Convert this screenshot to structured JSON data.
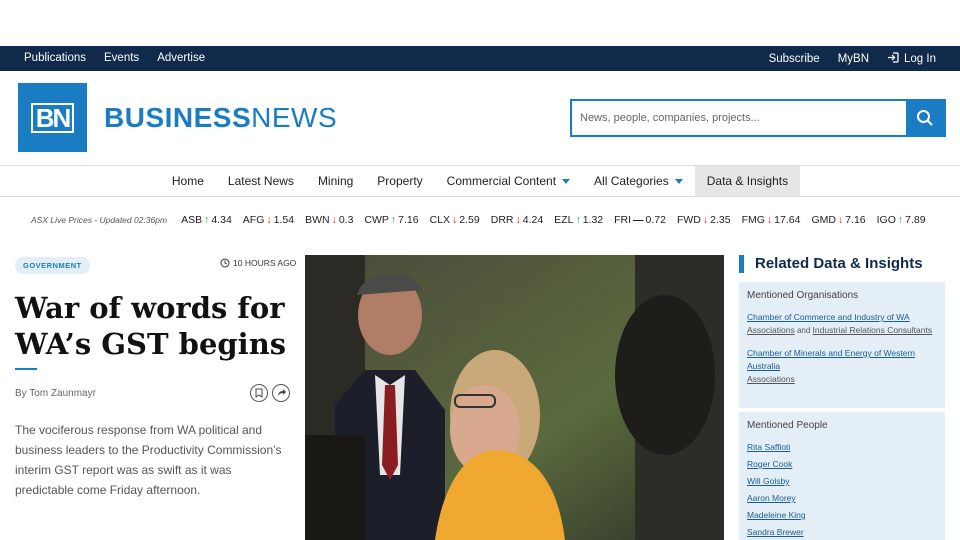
{
  "topbar": {
    "left_links": [
      "Publications",
      "Events",
      "Advertise"
    ],
    "subscribe": "Subscribe",
    "mybn": "MyBN",
    "login": "Log In"
  },
  "brand": {
    "logo_text": "BN",
    "name_bold": "BUSINESS",
    "name_light": "NEWS",
    "color": "#1a7dc4"
  },
  "search": {
    "placeholder": "News, people, companies, projects..."
  },
  "nav": {
    "home": "Home",
    "latest": "Latest News",
    "mining": "Mining",
    "property": "Property",
    "commercial": "Commercial Content",
    "categories": "All Categories",
    "data": "Data & Insights"
  },
  "ticker": {
    "updated": "ASX Live Prices - Updated 02:36pm",
    "items": [
      {
        "code": "ASB",
        "dir": "up",
        "value": "4.34"
      },
      {
        "code": "AFG",
        "dir": "down",
        "value": "1.54"
      },
      {
        "code": "BWN",
        "dir": "down",
        "value": "0.3"
      },
      {
        "code": "CWP",
        "dir": "up",
        "value": "7.16"
      },
      {
        "code": "CLX",
        "dir": "down",
        "value": "2.59"
      },
      {
        "code": "DRR",
        "dir": "down",
        "value": "4.24"
      },
      {
        "code": "EZL",
        "dir": "up",
        "value": "1.32"
      },
      {
        "code": "FRI",
        "dir": "flat",
        "value": "0.72"
      },
      {
        "code": "FWD",
        "dir": "down",
        "value": "2.35"
      },
      {
        "code": "FMG",
        "dir": "down",
        "value": "17.64"
      },
      {
        "code": "GMD",
        "dir": "down",
        "value": "7.16"
      },
      {
        "code": "IGO",
        "dir": "up",
        "value": "7.89"
      }
    ]
  },
  "article": {
    "category": "GOVERNMENT",
    "time": "10 HOURS AGO",
    "headline": "War of words for WA’s GST begins",
    "byline": "By Tom Zaunmayr",
    "lede": "The vociferous response from WA political and business leaders to the Productivity Commission’s interim GST report was as swift as it was predictable come Friday afternoon."
  },
  "sidebar": {
    "title": "Related Data & Insights",
    "orgs_heading": "Mentioned Organisations",
    "org1": "Chamber of Commerce and Industry of WA",
    "org1_cat1": "Associations",
    "and": "and",
    "org1_cat2": "Industrial Relations Consultants",
    "org2": "Chamber of Minerals and Energy of Western Australia",
    "org2_cat": "Associations",
    "people_heading": "Mentioned People",
    "people": [
      "Rita Saffioti",
      "Roger Cook",
      "Will Golsby",
      "Aaron Morey",
      "Madeleine King",
      "Sandra Brewer"
    ]
  }
}
